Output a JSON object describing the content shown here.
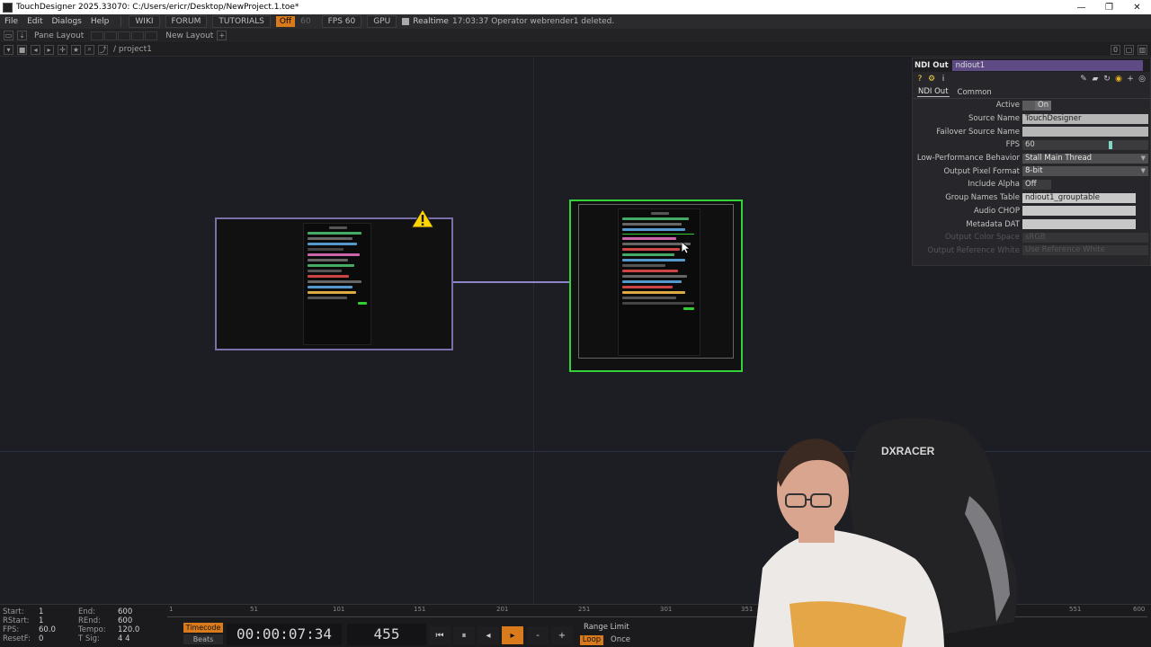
{
  "window": {
    "title": "TouchDesigner 2025.33070: C:/Users/ericr/Desktop/NewProject.1.toe*",
    "minimize": "—",
    "restore": "❐",
    "close": "✕"
  },
  "menu": {
    "items": [
      "File",
      "Edit",
      "Dialogs",
      "Help"
    ],
    "wiki": "WIKI",
    "forum": "FORUM",
    "tutorials": "TUTORIALS",
    "ofl": "Off",
    "ofl_num": "60",
    "fps": "FPS  60",
    "gpu": "GPU",
    "realtime": "Realtime",
    "status": "17:03:37 Operator webrender1 deleted."
  },
  "pane": {
    "pane_layout": "Pane Layout",
    "new_layout": "New Layout",
    "add": "+"
  },
  "path": {
    "text": "/ project1"
  },
  "params": {
    "op_type": "NDI Out",
    "op_name": "ndiout1",
    "tabs": [
      "NDI Out",
      "Common"
    ],
    "active_label": "Active",
    "active_value": "On",
    "source_name_label": "Source Name",
    "source_name_value": "TouchDesigner",
    "failover_label": "Failover Source Name",
    "failover_value": "",
    "fps_label": "FPS",
    "fps_value": "60",
    "lowperf_label": "Low-Performance Behavior",
    "lowperf_value": "Stall Main Thread",
    "pixfmt_label": "Output Pixel Format",
    "pixfmt_value": "8-bit",
    "alpha_label": "Include Alpha",
    "alpha_value": "Off",
    "group_label": "Group Names Table",
    "group_value": "ndiout1_grouptable",
    "audio_label": "Audio CHOP",
    "audio_value": "",
    "meta_label": "Metadata DAT",
    "meta_value": "",
    "colorspace_label": "Output Color Space",
    "colorspace_value": "sRGB",
    "refwhite_label": "Output Reference White",
    "refwhite_value": "Use Reference White"
  },
  "timeline": {
    "start_k": "Start:",
    "start_v": "1",
    "end_k": "End:",
    "end_v": "600",
    "rstart_k": "RStart:",
    "rstart_v": "1",
    "rend_k": "REnd:",
    "rend_v": "600",
    "fps_k": "FPS:",
    "fps_v": "60.0",
    "tempo_k": "Tempo:",
    "tempo_v": "120.0",
    "resetf_k": "ResetF:",
    "resetf_v": "0",
    "tsig_k": "T Sig:",
    "tsig_v": "4   4",
    "ruler_ticks": [
      "1",
      "51",
      "101",
      "151",
      "201",
      "251",
      "301",
      "351",
      "551",
      "600"
    ],
    "timecode_btn": "Timecode",
    "beats_btn": "Beats",
    "timecode": "00:00:07:34",
    "frame": "455",
    "range_limit": "Range Limit",
    "loop": "Loop",
    "once": "Once"
  },
  "colors": {
    "accent_orange": "#d97b1c",
    "node_selected": "#35d13a",
    "node_border": "#7a6fa8",
    "op_name_bg": "#5e4b86"
  },
  "webcam": {
    "chair_brand": "DXRACER"
  }
}
